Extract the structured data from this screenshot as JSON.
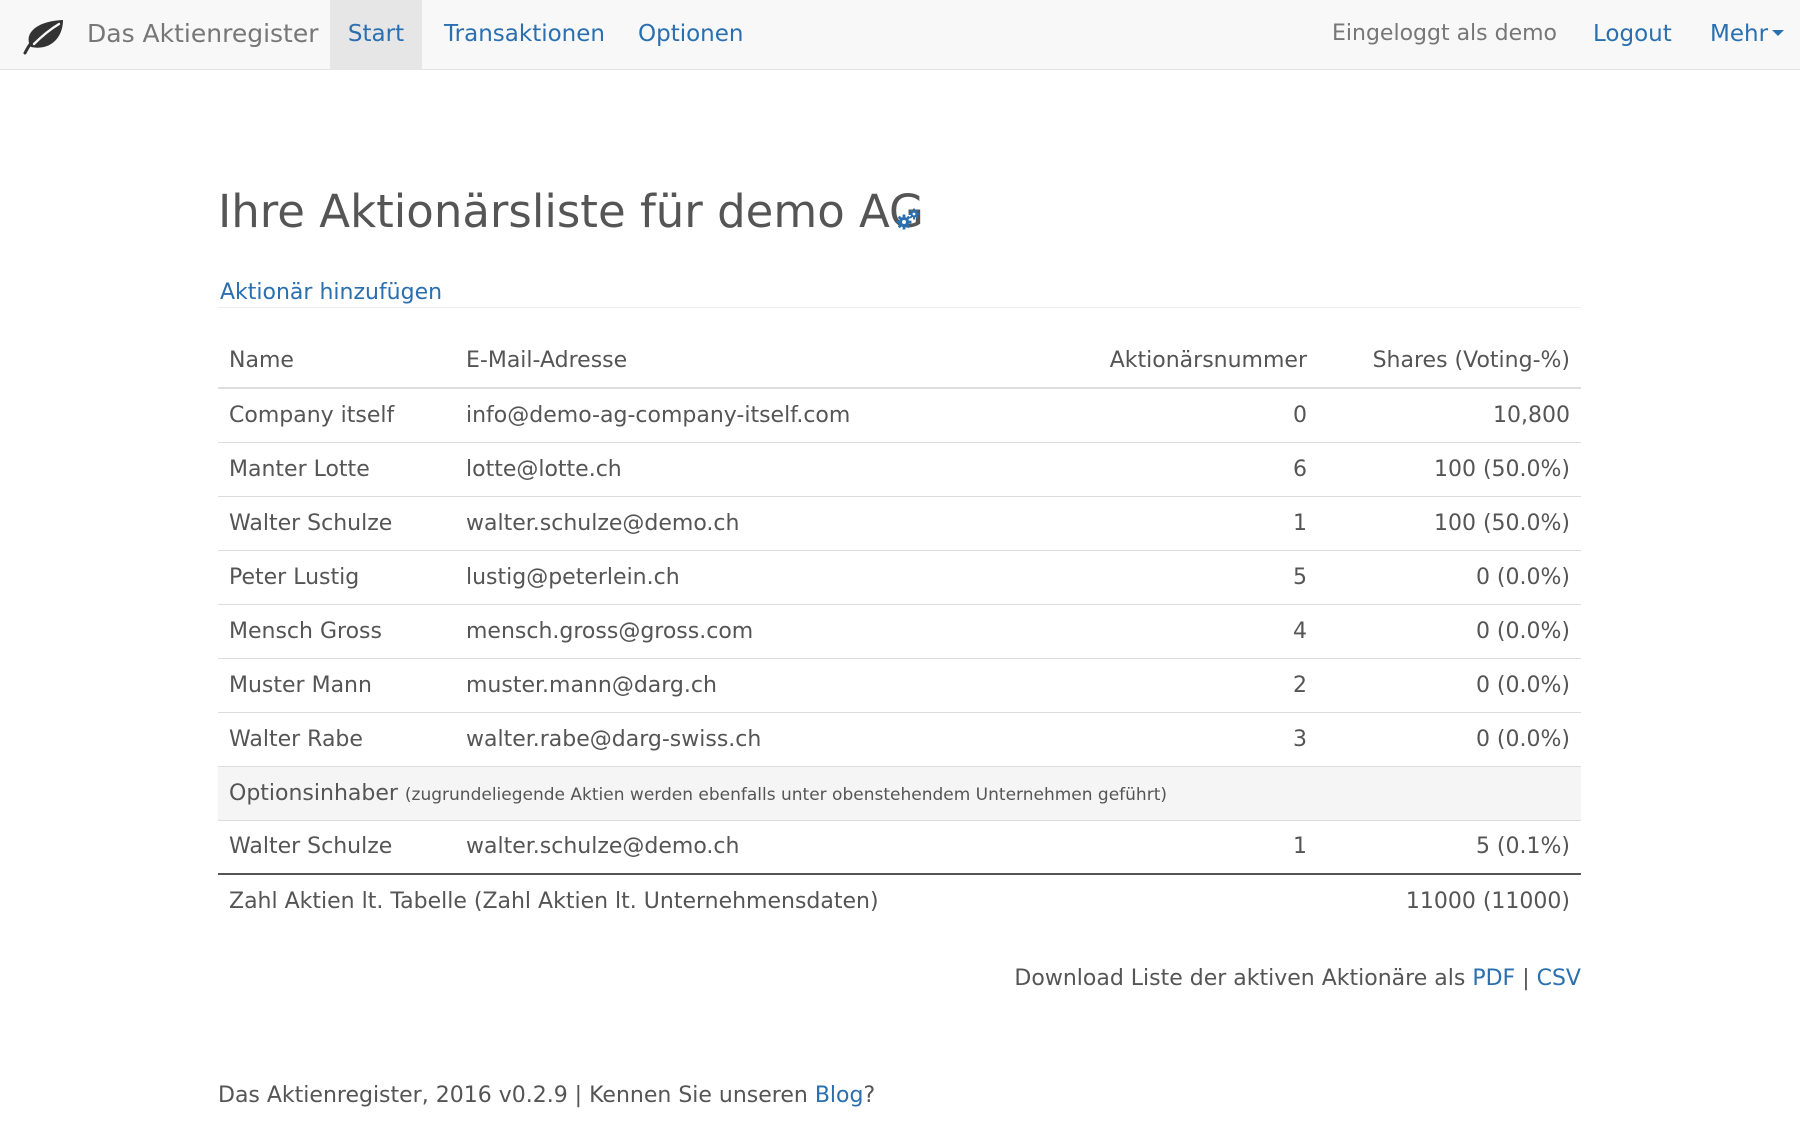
{
  "navbar": {
    "brand": "Das Aktienregister",
    "logo_icon": "leaf-icon",
    "items": [
      {
        "label": "Start",
        "active": true
      },
      {
        "label": "Transaktionen"
      },
      {
        "label": "Optionen"
      }
    ],
    "user_text": "Eingeloggt als demo",
    "logout_label": "Logout",
    "more_label": "Mehr"
  },
  "main": {
    "title": "Ihre Aktionärsliste für demo AG",
    "title_icon": "gears-icon",
    "add_shareholder_label": "Aktionär hinzufügen"
  },
  "table": {
    "headers": {
      "name": "Name",
      "email": "E-Mail-Adresse",
      "number": "Aktionärsnummer",
      "shares": "Shares (Voting-%)"
    },
    "rows": [
      {
        "name": "Company itself",
        "email": "info@demo-ag-company-itself.com",
        "number": "0",
        "shares": "10,800"
      },
      {
        "name": "Manter Lotte",
        "email": "lotte@lotte.ch",
        "number": "6",
        "shares": "100 (50.0%)"
      },
      {
        "name": "Walter Schulze",
        "email": "walter.schulze@demo.ch",
        "number": "1",
        "shares": "100 (50.0%)"
      },
      {
        "name": "Peter Lustig",
        "email": "lustig@peterlein.ch",
        "number": "5",
        "shares": "0 (0.0%)"
      },
      {
        "name": "Mensch Gross",
        "email": "mensch.gross@gross.com",
        "number": "4",
        "shares": "0 (0.0%)"
      },
      {
        "name": "Muster Mann",
        "email": "muster.mann@darg.ch",
        "number": "2",
        "shares": "0 (0.0%)"
      },
      {
        "name": "Walter Rabe",
        "email": "walter.rabe@darg-swiss.ch",
        "number": "3",
        "shares": "0 (0.0%)"
      }
    ],
    "option_section": {
      "label": "Optionsinhaber",
      "note": "(zugrundeliegende Aktien werden ebenfalls unter obenstehendem Unternehmen geführt)"
    },
    "option_rows": [
      {
        "name": "Walter Schulze",
        "email": "walter.schulze@demo.ch",
        "number": "1",
        "shares": "5 (0.1%)"
      }
    ],
    "total": {
      "label": "Zahl Aktien lt. Tabelle (Zahl Aktien lt. Unternehmensdaten)",
      "value": "11000 (11000)"
    }
  },
  "downloads": {
    "prefix": "Download Liste der aktiven Aktionäre als",
    "pdf_label": "PDF",
    "separator": "|",
    "csv_label": "CSV"
  },
  "footer": {
    "text": "Das Aktienregister, 2016 v0.2.9 | Kennen Sie unseren",
    "blog_label": "Blog",
    "suffix": "?"
  },
  "colors": {
    "link": "#2a6fb0",
    "navbar_bg": "#f8f8f8",
    "active_tab_bg": "#e6e6e6",
    "text": "#555555"
  }
}
